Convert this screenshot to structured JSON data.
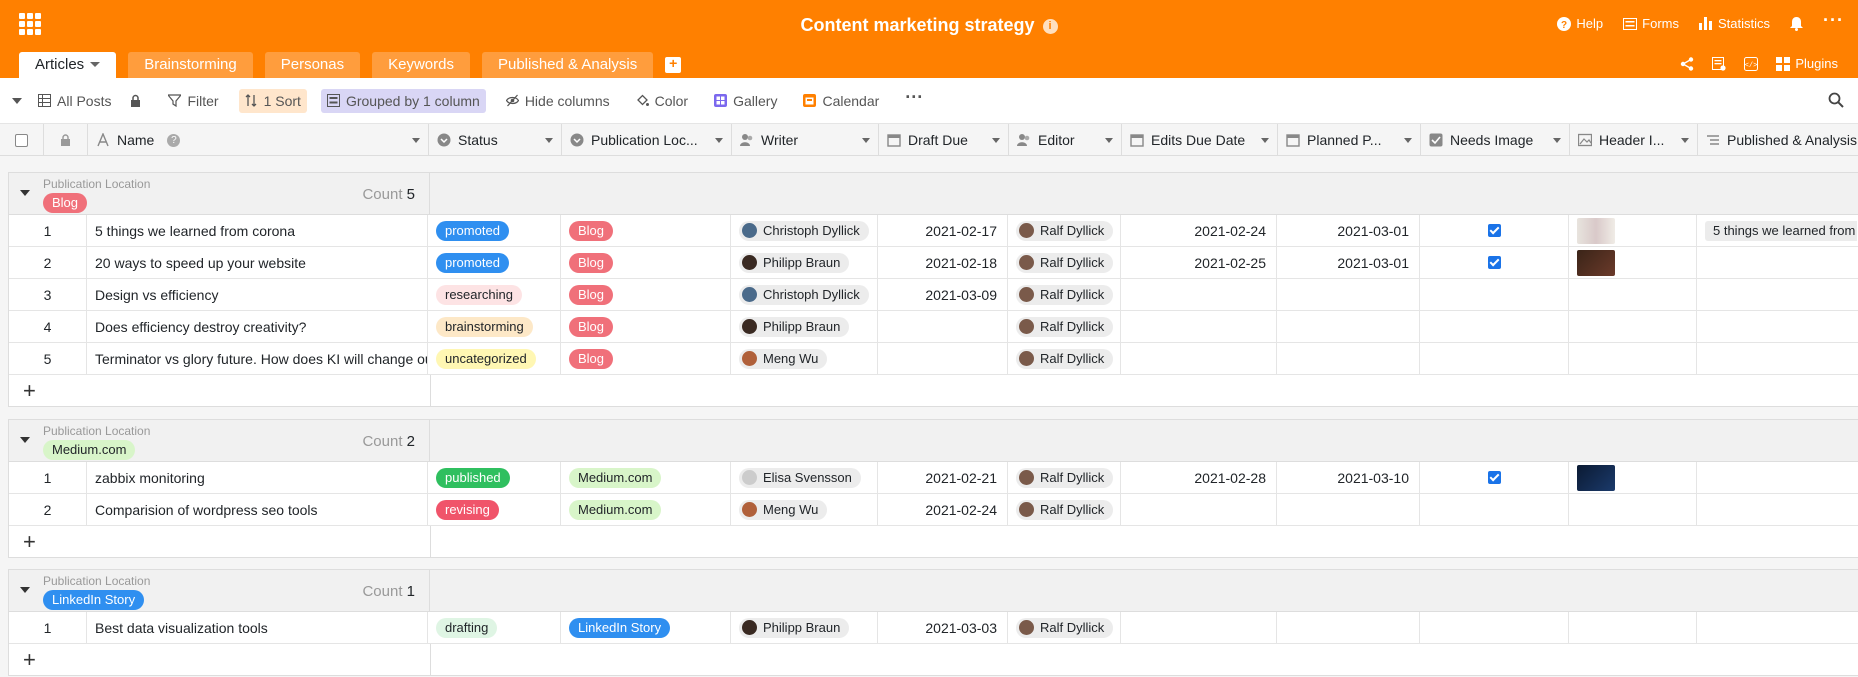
{
  "app": {
    "title": "Content marketing strategy"
  },
  "topbar": {
    "help": "Help",
    "forms": "Forms",
    "statistics": "Statistics"
  },
  "tabs": [
    "Articles",
    "Brainstorming",
    "Personas",
    "Keywords",
    "Published & Analysis"
  ],
  "tabs_right": {
    "plugins": "Plugins"
  },
  "toolbar": {
    "view": "All Posts",
    "filter": "Filter",
    "sort": "1 Sort",
    "group": "Grouped by 1 column",
    "hide": "Hide columns",
    "color": "Color",
    "gallery": "Gallery",
    "calendar": "Calendar"
  },
  "columns": [
    "Name",
    "Status",
    "Publication Loc...",
    "Writer",
    "Draft Due",
    "Editor",
    "Edits Due Date",
    "Planned P...",
    "Needs Image",
    "Header I...",
    "Published & Analysis"
  ],
  "groups": [
    {
      "label": "Publication Location",
      "value": "Blog",
      "value_color": "#f0707a",
      "value_text_color": "#ffffff",
      "count_label": "Count",
      "count": "5",
      "rows": [
        {
          "n": "1",
          "name": "5 things we learned from corona",
          "status": "promoted",
          "status_bg": "#2f8ff0",
          "status_fg": "#ffffff",
          "loc": "Blog",
          "writer": "Christoph Dyllick",
          "draft": "2021-02-17",
          "editor": "Ralf Dyllick",
          "edits": "2021-02-24",
          "planned": "2021-03-01",
          "needs_image": true,
          "header": "light",
          "published": "5 things we learned from"
        },
        {
          "n": "2",
          "name": "20 ways to speed up your website",
          "status": "promoted",
          "status_bg": "#2f8ff0",
          "status_fg": "#ffffff",
          "loc": "Blog",
          "writer": "Philipp Braun",
          "draft": "2021-02-18",
          "editor": "Ralf Dyllick",
          "edits": "2021-02-25",
          "planned": "2021-03-01",
          "needs_image": true,
          "header": "dark",
          "published": ""
        },
        {
          "n": "3",
          "name": "Design vs efficiency",
          "status": "researching",
          "status_bg": "#fde3e4",
          "status_fg": "#212529",
          "loc": "Blog",
          "writer": "Christoph Dyllick",
          "draft": "2021-03-09",
          "editor": "Ralf Dyllick",
          "edits": "",
          "planned": "",
          "needs_image": false,
          "header": "",
          "published": ""
        },
        {
          "n": "4",
          "name": "Does efficiency destroy creativity?",
          "status": "brainstorming",
          "status_bg": "#fde8c7",
          "status_fg": "#212529",
          "loc": "Blog",
          "writer": "Philipp Braun",
          "draft": "",
          "editor": "Ralf Dyllick",
          "edits": "",
          "planned": "",
          "needs_image": false,
          "header": "",
          "published": ""
        },
        {
          "n": "5",
          "name": "Terminator vs glory future. How does KI will change our lives",
          "status": "uncategorized",
          "status_bg": "#fff7b3",
          "status_fg": "#212529",
          "loc": "Blog",
          "writer": "Meng Wu",
          "draft": "",
          "editor": "Ralf Dyllick",
          "edits": "",
          "planned": "",
          "needs_image": false,
          "header": "",
          "published": ""
        }
      ]
    },
    {
      "label": "Publication Location",
      "value": "Medium.com",
      "value_color": "#d8f5c9",
      "value_text_color": "#212529",
      "count_label": "Count",
      "count": "2",
      "rows": [
        {
          "n": "1",
          "name": "zabbix monitoring",
          "status": "published",
          "status_bg": "#2fbf5f",
          "status_fg": "#ffffff",
          "loc": "Medium.com",
          "writer": "Elisa Svensson",
          "draft": "2021-02-21",
          "editor": "Ralf Dyllick",
          "edits": "2021-02-28",
          "planned": "2021-03-10",
          "needs_image": true,
          "header": "navy",
          "published": ""
        },
        {
          "n": "2",
          "name": "Comparision of wordpress seo tools",
          "status": "revising",
          "status_bg": "#f0546a",
          "status_fg": "#ffffff",
          "loc": "Medium.com",
          "writer": "Meng Wu",
          "draft": "2021-02-24",
          "editor": "Ralf Dyllick",
          "edits": "",
          "planned": "",
          "needs_image": false,
          "header": "",
          "published": ""
        }
      ]
    },
    {
      "label": "Publication Location",
      "value": "LinkedIn Story",
      "value_color": "#2f8ff0",
      "value_text_color": "#ffffff",
      "count_label": "Count",
      "count": "1",
      "rows": [
        {
          "n": "1",
          "name": "Best data visualization tools",
          "status": "drafting",
          "status_bg": "#dff5e4",
          "status_fg": "#212529",
          "loc": "LinkedIn Story",
          "writer": "Philipp Braun",
          "draft": "2021-03-03",
          "editor": "Ralf Dyllick",
          "edits": "",
          "planned": "",
          "needs_image": false,
          "header": "",
          "published": ""
        }
      ]
    }
  ],
  "colors": {
    "brand": "#ff8000",
    "sort_chip": "#ffe6cc",
    "group_chip": "#d9d6f5"
  }
}
